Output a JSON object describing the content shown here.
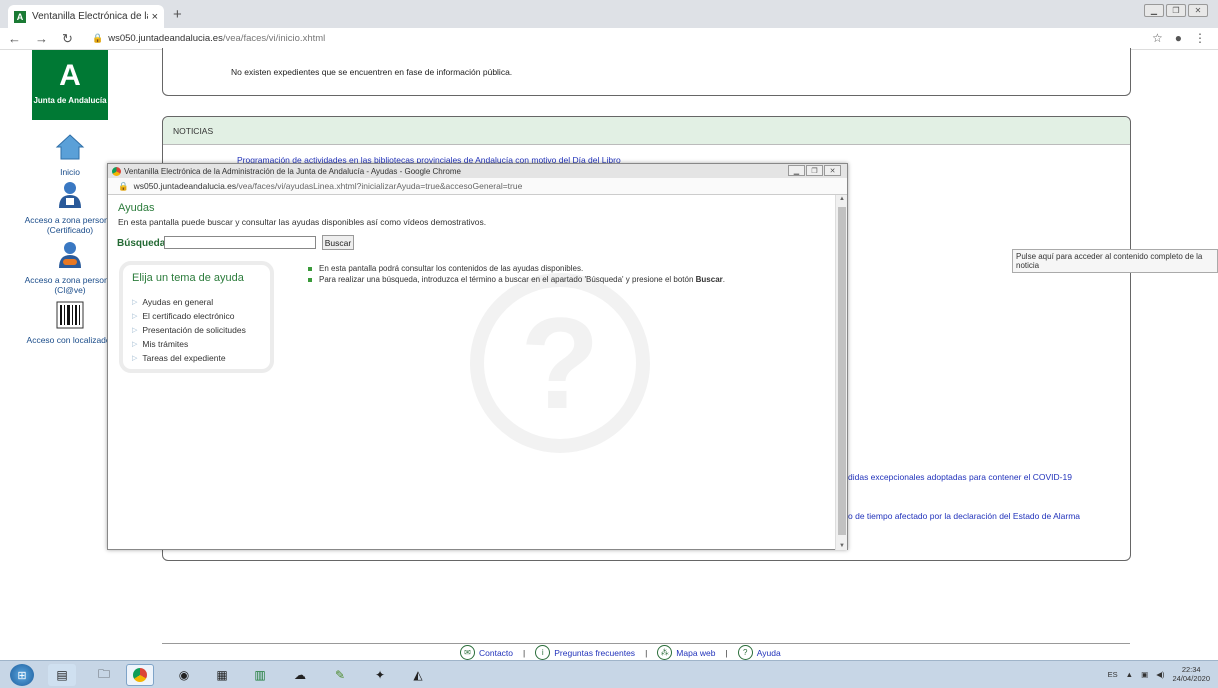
{
  "browser": {
    "tab_title": "Ventanilla Electrónica de la Adm",
    "tab_close": "×",
    "new_tab": "+",
    "url_host": "ws050.juntadeandalucia.es",
    "url_path": "/vea/faces/vi/inicio.xhtml"
  },
  "sidebar": {
    "logo_letter": "A",
    "logo_name": "Junta de Andalucía",
    "items": [
      {
        "label": "Inicio"
      },
      {
        "label": "Acceso a zona personal (Certificado)"
      },
      {
        "label": "Acceso a zona personal (Cl@ve)"
      },
      {
        "label": "Acceso con localizador"
      }
    ]
  },
  "main": {
    "no_expedientes": "No existen expedientes que se encuentren en fase de información pública.",
    "notices_title": "NOTICIAS",
    "news": [
      "Programación de actividades en las bibliotecas provinciales de Andalucía con motivo del Día del Libro",
      "didas excepcionales adoptadas para contener el COVID-19",
      "o de tiempo afectado por la declaración del Estado de Alarma"
    ],
    "tooltip": "Pulse aquí para acceder al contenido completo de la noticia"
  },
  "popup": {
    "title": "Ventanilla Electrónica de la Administración de la Junta de Andalucía - Ayudas - Google Chrome",
    "url_host": "ws050.juntadeandalucia.es",
    "url_path": "/vea/faces/vi/ayudasLinea.xhtml?inicializarAyuda=true&accesoGeneral=true",
    "heading": "Ayudas",
    "description": "En esta pantalla puede buscar y consultar las ayudas disponibles así como vídeos demostrativos.",
    "search_label": "Búsqueda",
    "search_value": "",
    "search_button": "Buscar",
    "topic_title": "Elija un tema de ayuda",
    "topics": [
      "Ayudas en general",
      "El certificado electrónico",
      "Presentación de solicitudes",
      "Mis trámites",
      "Tareas del expediente"
    ],
    "bullet1": "En esta pantalla podrá consultar los contenidos de las ayudas disponibles.",
    "bullet2_pre": "Para realizar una búsqueda, introduzca el término a buscar en el apartado 'Búsqueda' y presione el botón ",
    "bullet2_bold": "Buscar",
    "bullet2_post": ".",
    "watermark": "?"
  },
  "footer": {
    "contacto": "Contacto",
    "preguntas": "Preguntas frecuentes",
    "mapa": "Mapa web",
    "ayuda": "Ayuda",
    "separator": "|"
  },
  "taskbar": {
    "lang": "ES",
    "time": "22:34",
    "date": "24/04/2020"
  },
  "colors": {
    "brand_green": "#007934",
    "link_blue": "#2233bb",
    "notice_header": "#e2f0e4"
  }
}
